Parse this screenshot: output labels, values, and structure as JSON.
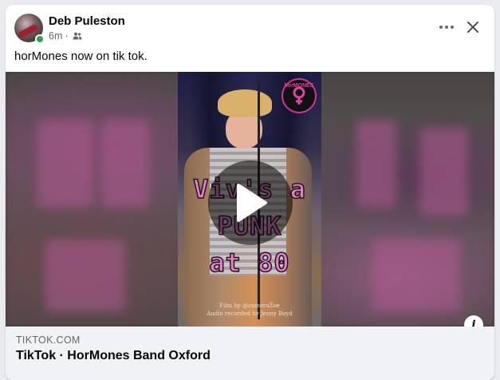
{
  "post": {
    "author": "Deb Puleston",
    "time": "6m",
    "separator": "·",
    "audience_icon": "friends-icon",
    "text": "horMones now on tik tok."
  },
  "actions": {
    "more_icon": "more-options-icon",
    "close_icon": "close-icon"
  },
  "video": {
    "overlay_lines": [
      "Viv's a",
      "PUNK",
      "at 80"
    ],
    "logo_text": "horMONES",
    "credit_line_1": "Film by @cameraZoe",
    "credit_line_2": "Audio recorded by Jenny Boyd",
    "play_icon": "play-icon",
    "info_icon": "info-icon",
    "info_glyph": "i"
  },
  "link_preview": {
    "domain": "TIKTOK.COM",
    "title": "TikTok · HorMones Band Oxford"
  },
  "colors": {
    "online": "#31a24c",
    "overlay_text": "#f07bd0",
    "link_bar_bg": "#f0f2f5"
  }
}
